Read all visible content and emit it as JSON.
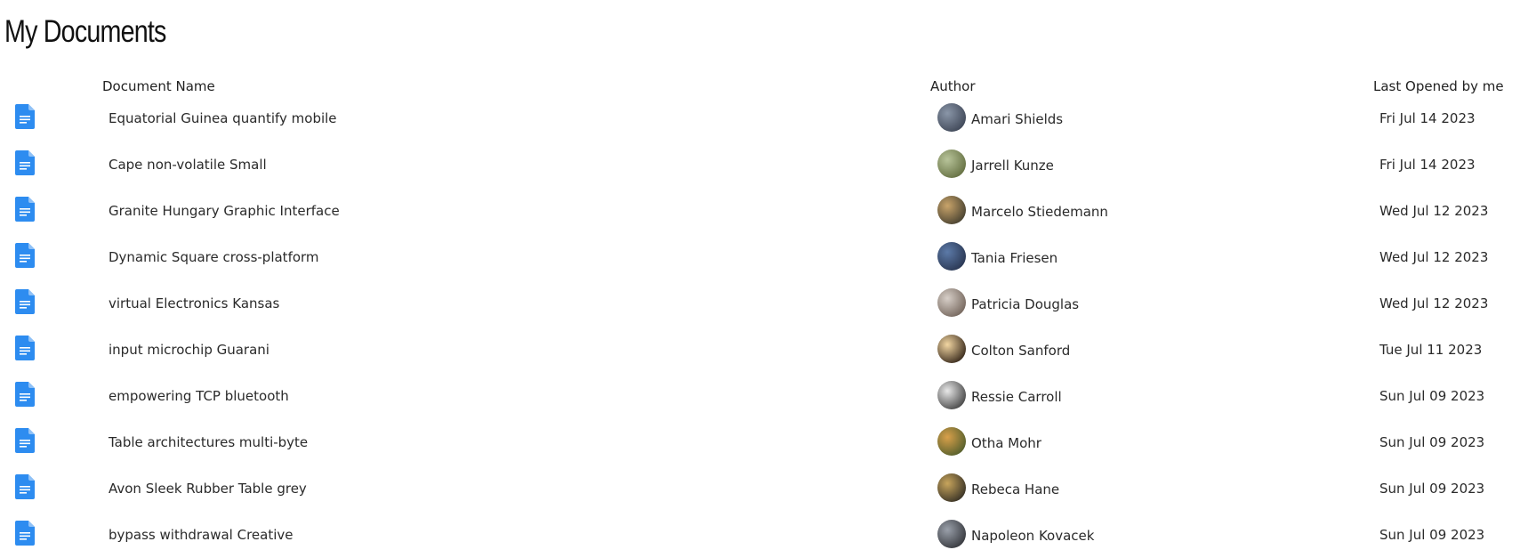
{
  "page": {
    "title": "My Documents"
  },
  "table": {
    "headers": {
      "name": "Document Name",
      "author": "Author",
      "last_opened": "Last Opened by me"
    },
    "icon": "document-icon",
    "accent_color": "#2d8cf0",
    "rows": [
      {
        "name": "Equatorial Guinea quantify mobile",
        "author": "Amari Shields",
        "date": "Fri Jul 14 2023",
        "avatar_colors": [
          "#8a96a8",
          "#3a4252"
        ]
      },
      {
        "name": "Cape non-volatile Small",
        "author": "Jarrell Kunze",
        "date": "Fri Jul 14 2023",
        "avatar_colors": [
          "#b8c49a",
          "#5f6a3c"
        ]
      },
      {
        "name": "Granite Hungary Graphic Interface",
        "author": "Marcelo Stiedemann",
        "date": "Wed Jul 12 2023",
        "avatar_colors": [
          "#c9a46a",
          "#3e3a2c"
        ]
      },
      {
        "name": "Dynamic Square cross-platform",
        "author": "Tania Friesen",
        "date": "Wed Jul 12 2023",
        "avatar_colors": [
          "#5c7aa8",
          "#26324c"
        ]
      },
      {
        "name": "virtual Electronics Kansas",
        "author": "Patricia Douglas",
        "date": "Wed Jul 12 2023",
        "avatar_colors": [
          "#d7cfc8",
          "#6e5f55"
        ]
      },
      {
        "name": "input microchip Guarani",
        "author": "Colton Sanford",
        "date": "Tue Jul 11 2023",
        "avatar_colors": [
          "#f2d6a2",
          "#2b1d12"
        ]
      },
      {
        "name": "empowering TCP bluetooth",
        "author": "Ressie Carroll",
        "date": "Sun Jul 09 2023",
        "avatar_colors": [
          "#e8e8e8",
          "#3b3b3b"
        ]
      },
      {
        "name": "Table architectures multi-byte",
        "author": "Otha Mohr",
        "date": "Sun Jul 09 2023",
        "avatar_colors": [
          "#d9a04a",
          "#4a5a2a"
        ]
      },
      {
        "name": "Avon Sleek Rubber Table grey",
        "author": "Rebeca Hane",
        "date": "Sun Jul 09 2023",
        "avatar_colors": [
          "#c8a55c",
          "#2e2a22"
        ]
      },
      {
        "name": "bypass withdrawal Creative",
        "author": "Napoleon Kovacek",
        "date": "Sun Jul 09 2023",
        "avatar_colors": [
          "#9aa0aa",
          "#2f3136"
        ]
      }
    ]
  }
}
